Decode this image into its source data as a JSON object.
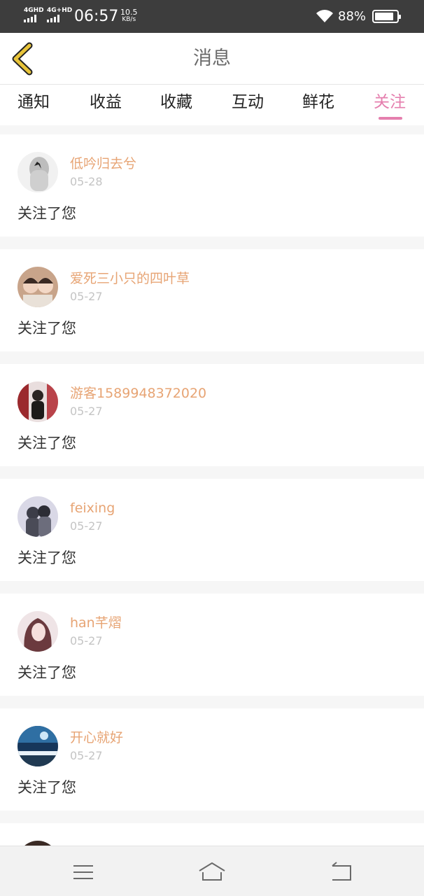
{
  "status_bar": {
    "net1": "4GHD",
    "net2": "4G+HD",
    "time": "06:57",
    "speed_value": "10.5",
    "speed_unit": "KB/s",
    "battery_pct": "88%",
    "battery_level": 0.88,
    "icons": [
      "signal-icon",
      "wifi-icon",
      "battery-icon"
    ]
  },
  "header": {
    "title": "消息",
    "back_icon": "chevron-left-icon"
  },
  "tabs": [
    {
      "label": "通知"
    },
    {
      "label": "收益"
    },
    {
      "label": "收藏"
    },
    {
      "label": "互动"
    },
    {
      "label": "鲜花"
    },
    {
      "label": "关注"
    }
  ],
  "active_tab": "关注",
  "colors": {
    "accent": "#e57fae",
    "username": "#e7a474",
    "date": "#c4c4c4",
    "back_icon": "#e8c43a"
  },
  "follow_list": [
    {
      "username": "低吟归去兮",
      "date": "05-28",
      "action": "关注了您"
    },
    {
      "username": "爱死三小只的四叶草",
      "date": "05-27",
      "action": "关注了您"
    },
    {
      "username": "游客1589948372020",
      "date": "05-27",
      "action": "关注了您"
    },
    {
      "username": "feixing",
      "date": "05-27",
      "action": "关注了您"
    },
    {
      "username": "han芊熠",
      "date": "05-27",
      "action": "关注了您"
    },
    {
      "username": "开心就好",
      "date": "05-27",
      "action": "关注了您"
    }
  ],
  "bottom_nav": {
    "icons": [
      "menu-icon",
      "home-icon",
      "back-icon"
    ]
  }
}
